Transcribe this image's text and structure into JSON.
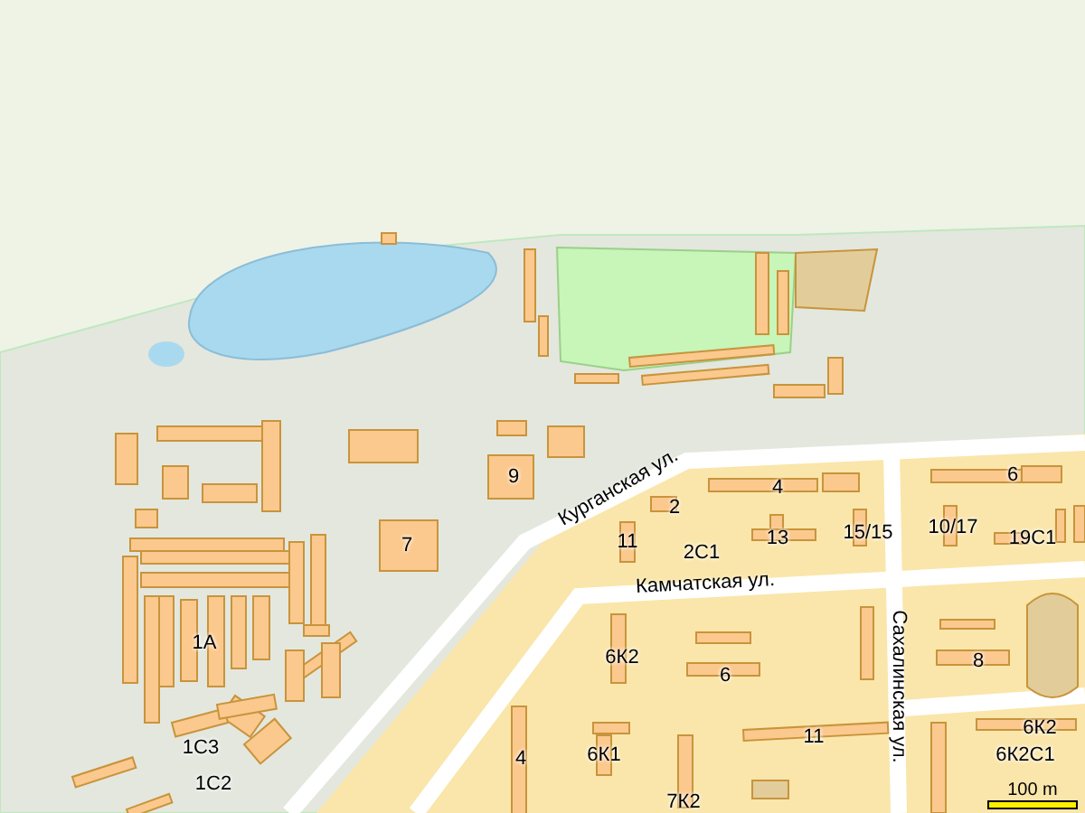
{
  "map": {
    "street_labels": [
      {
        "text": "Курганская ул.",
        "kind": "diagonal"
      },
      {
        "text": "Камчатская ул.",
        "kind": "horizontal"
      },
      {
        "text": "Сахалинская ул.",
        "kind": "vertical"
      }
    ],
    "building_labels": [
      "9",
      "7",
      "4",
      "2",
      "11",
      "2С1",
      "13",
      "15/15",
      "6",
      "10/17",
      "19С1",
      "1А",
      "1С3",
      "1С2",
      "6К2",
      "6",
      "8",
      "4",
      "6К1",
      "11",
      "6К2",
      "6К2С1",
      "7К2"
    ],
    "scale_bar": {
      "label": "100 m"
    }
  }
}
